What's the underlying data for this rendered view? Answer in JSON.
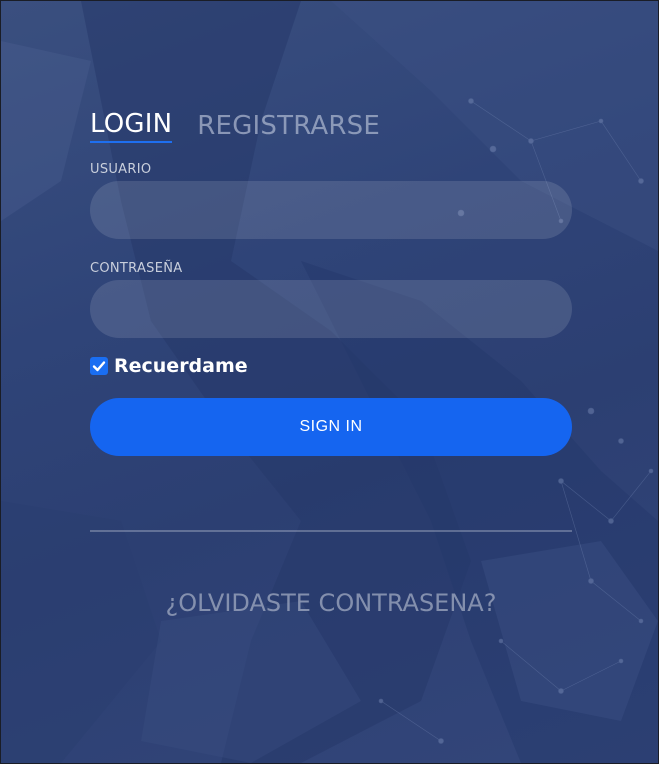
{
  "tabs": {
    "login_label": "LOGIN",
    "register_label": "REGISTRARSE"
  },
  "form": {
    "username_label": "USUARIO",
    "username_value": "",
    "password_label": "CONTRASEÑA",
    "password_value": "",
    "remember_label": "Recuerdame",
    "remember_checked": true,
    "signin_label": "SIGN IN"
  },
  "links": {
    "forgot_label": "¿OLVIDASTE CONTRASENA?"
  },
  "colors": {
    "accent": "#1565f0",
    "background": "#2f4478",
    "text": "#ffffff"
  },
  "icons": {
    "checkbox": "check-icon"
  }
}
